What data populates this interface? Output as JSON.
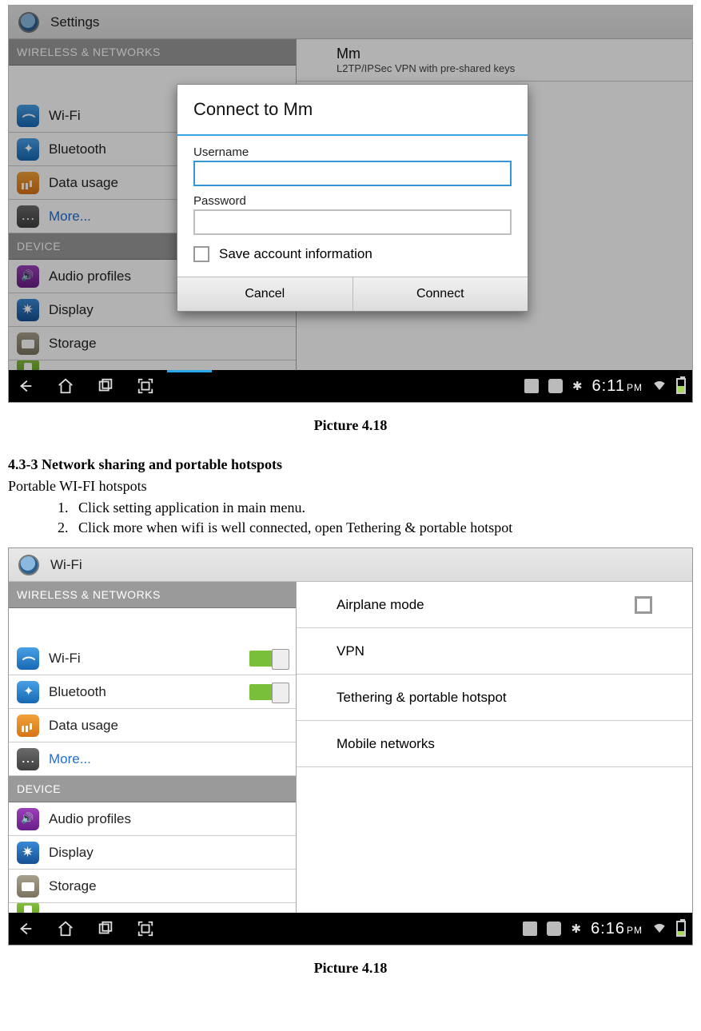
{
  "captions": {
    "c1": "Picture 4.18",
    "c2": "Picture 4.18"
  },
  "text": {
    "section_title": "4.3-3 Network sharing and portable hotspots",
    "subtitle": "Portable WI-FI hotspots",
    "steps": [
      "Click setting application in main menu.",
      "Click more when wifi is well connected, open Tethering & portable hotspot"
    ]
  },
  "shot1": {
    "titlebar": "Settings",
    "sidebar": {
      "cat1": "WIRELESS & NETWORKS",
      "cat2": "DEVICE",
      "wifi": "Wi-Fi",
      "bluetooth": "Bluetooth",
      "data": "Data usage",
      "more": "More...",
      "audio": "Audio profiles",
      "display": "Display",
      "storage": "Storage"
    },
    "vpn": {
      "name": "Mm",
      "type": "L2TP/IPSec VPN with pre-shared keys"
    },
    "dialog": {
      "title": "Connect to Mm",
      "username_label": "Username",
      "password_label": "Password",
      "save_label": "Save account information",
      "cancel": "Cancel",
      "connect": "Connect"
    },
    "status": {
      "time": "6:11",
      "ampm": "PM"
    }
  },
  "shot2": {
    "titlebar": "Wi-Fi",
    "sidebar": {
      "cat1": "WIRELESS & NETWORKS",
      "cat2": "DEVICE",
      "wifi": "Wi-Fi",
      "bluetooth": "Bluetooth",
      "data": "Data usage",
      "more": "More...",
      "audio": "Audio profiles",
      "display": "Display",
      "storage": "Storage"
    },
    "options": {
      "airplane": "Airplane mode",
      "vpn": "VPN",
      "tether": "Tethering & portable hotspot",
      "mobile": "Mobile networks"
    },
    "status": {
      "time": "6:16",
      "ampm": "PM"
    }
  }
}
